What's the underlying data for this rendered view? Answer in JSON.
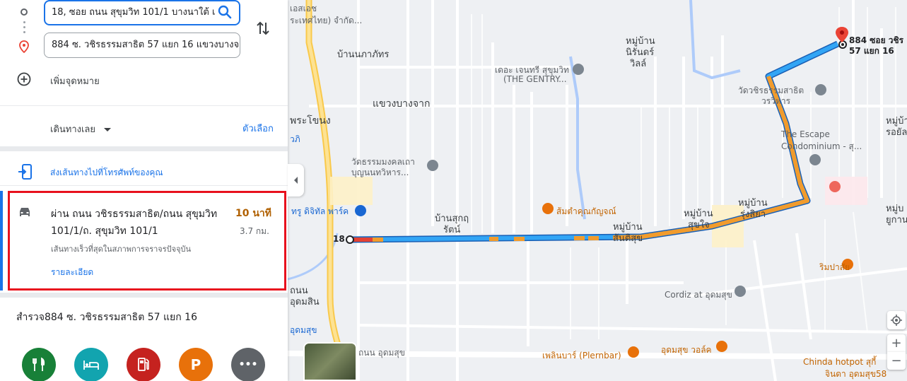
{
  "directions": {
    "origin_value": "18, ซอย ถนน สุขุมวิท 101/1 บางนาใต้ เ",
    "destination_value": "884 ซ. วชิรธรรมสาธิต 57 แยก 16 แขวงบางจ",
    "add_destination_label": "เพิ่มจุดหมาย",
    "travel_mode_label": "เดินทางเลย",
    "options_label": "ตัวเลือก",
    "send_to_phone_label": "ส่งเส้นทางไปที่โทรศัพท์ของคุณ"
  },
  "route": {
    "title_line1": "ผ่าน ถนน วชิรธรรมสาธิต/ถนน สุขุมวิท",
    "title_line2": "101/1/ถ. สุขุมวิท 101/1",
    "duration": "10 นาที",
    "distance": "3.7 กม.",
    "description": "เส้นทางเร็วที่สุดในสภาพการจราจรปัจจุบัน",
    "details_label": "รายละเอียด"
  },
  "explore": {
    "title": "สำรวจ884 ซ. วชิรธรรมสาธิต 57 แยก 16",
    "categories": [
      {
        "icon": "restaurant-icon",
        "color": "#188038"
      },
      {
        "icon": "hotel-icon",
        "color": "#12a4af"
      },
      {
        "icon": "gas-station-icon",
        "color": "#c5221f"
      },
      {
        "icon": "parking-icon",
        "color": "#e8710a"
      },
      {
        "icon": "more-icon",
        "color": "#5f6368"
      }
    ],
    "parking_glyph": "P",
    "more_glyph": "•••"
  },
  "map": {
    "labels": {
      "company": "เอสเอช",
      "company2": "ระเทศไทย) จำกัด...",
      "ban_phuttarat": "บ้านนภาภัทร",
      "gentry": "เดอะ เจนทรี สุขุมวิท",
      "gentry2": "(THE GENTRY...",
      "niran": "หมู่บ้าน",
      "niran2": "นิรันดร์",
      "niran3": "วิลล์",
      "bangchak": "แขวงบางจาก",
      "phrakhanong": "พระโขนง",
      "wat_mongkol": "วัดธรรมมงคลเถา",
      "wat_mongkol2": "บุญนนทวิหาร...",
      "digital_park": "ทรู ดิจิทัล พาร์ค",
      "ban_sukrit": "บ้านสุกฤ",
      "ban_sukrit2": "รัตน์",
      "restaurant": "ส้มตำคุณกัญจณ์",
      "sansuk": "หมู่บ้าน",
      "sansuk2": "สันติสุข",
      "sukjai": "หมู่บ้าน",
      "sukjai2": "สุขใจ",
      "rungsiya": "หมู่บ้าน",
      "rungsiya2": "รุ่งสิยา",
      "wat_vachira": "วัดวชิรธรรมสาธิต",
      "wat_vachira2": "วรวิหาร",
      "escape": "The Escape",
      "escape2": "Condominium - สุ...",
      "dest_line1": "884 ซอย วชิร",
      "dest_line2": "57 แยก 16",
      "origin_label": "18",
      "cordiz": "Cordiz at อุดมสุข",
      "udomsuk_walk": "อุดมสุข วอล์ค",
      "plernbar": "เพลินบาร์ (Plernbar)",
      "chinda": "Chinda hotpot สุกี้",
      "chinda2": "จินดา อุดมสุข58",
      "udomsuk_road": "ถนน อุดมสุข",
      "udomsuk_station": "อุดมสุข",
      "rimpasai": "ริมปาสัย",
      "moo_ban_right": "หมู่บ้า",
      "moo_ban_right2": "รอยัลบ",
      "moo_ban_right3": "หมู่บ",
      "moo_ban_right4": "ยูกาน",
      "thanon": "ถนน",
      "thanon2": "อุดมสุข",
      "bangkwi": "วภิ",
      "udomsuk_left": "ถนน",
      "udomsuk_left2": "อุดมสิน"
    },
    "zoom_in": "+",
    "zoom_out": "−"
  }
}
